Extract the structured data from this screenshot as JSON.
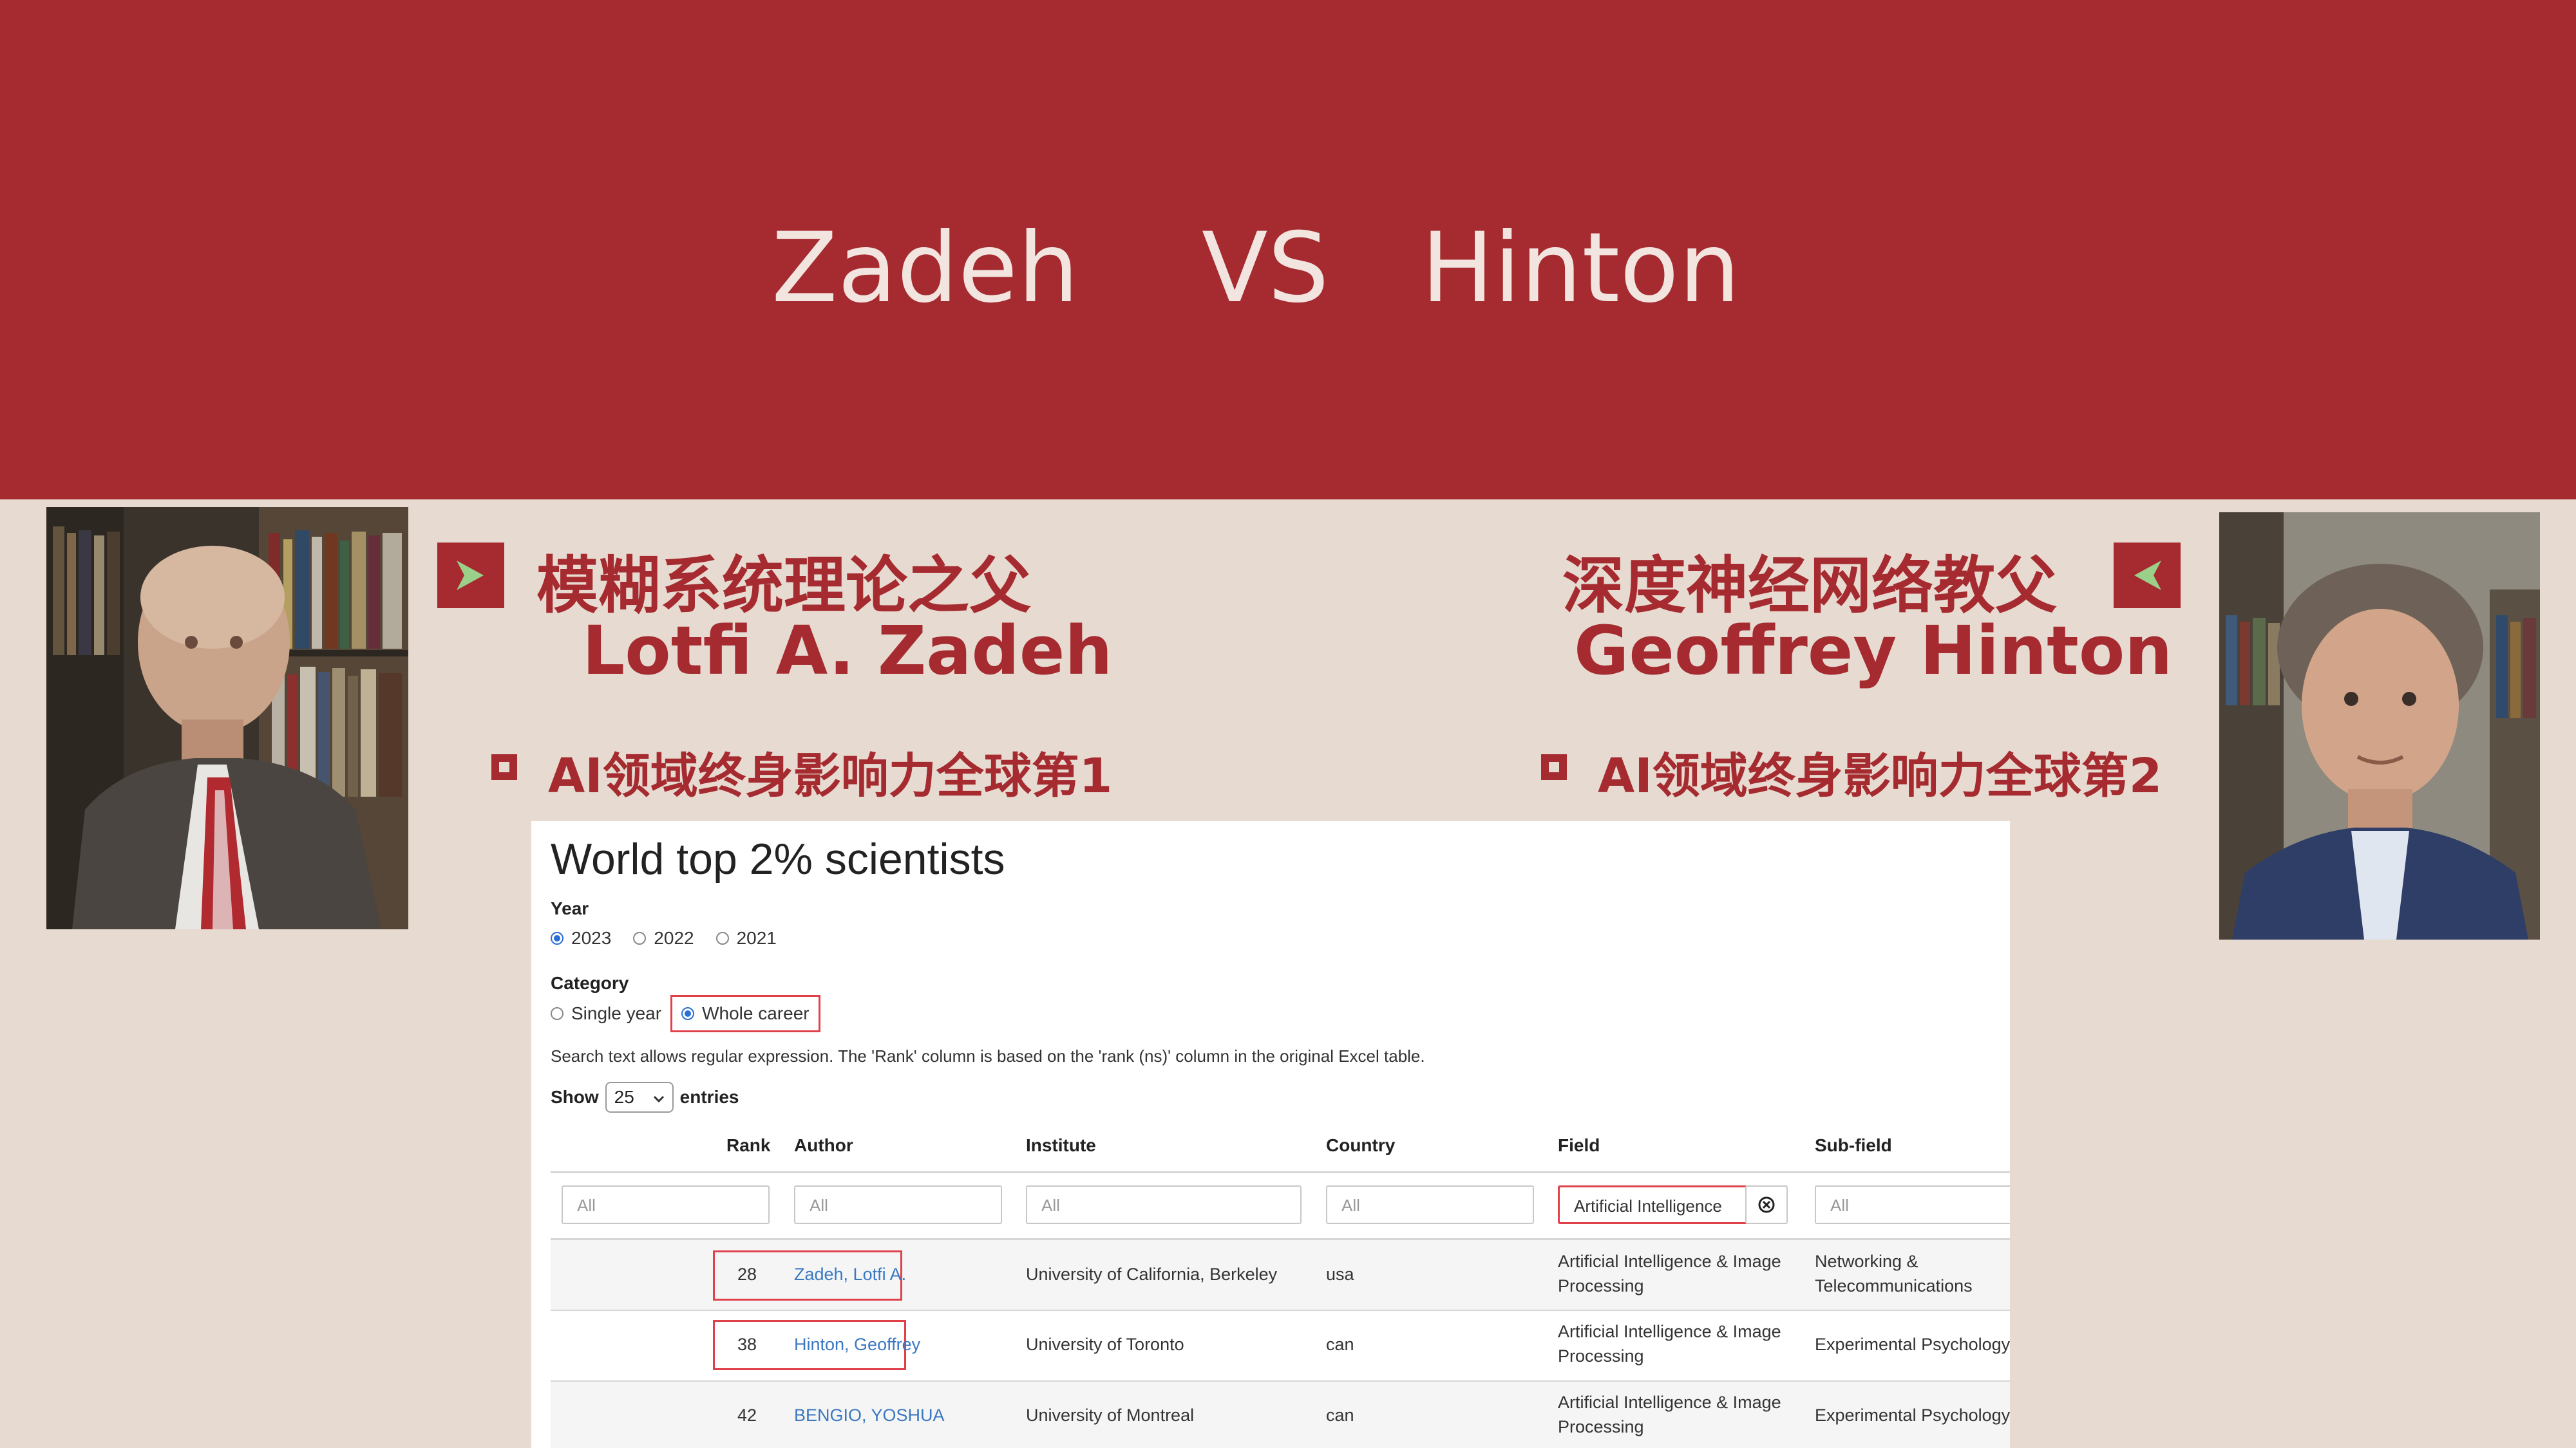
{
  "banner": {
    "title": "Zadeh    VS   Hinton"
  },
  "left": {
    "title_zh": "模糊系统理论之父",
    "name": "Lotfi A. Zadeh",
    "bullet": "AI领域终身影响力全球第1"
  },
  "right": {
    "title_zh": "深度神经网络教父",
    "name": "Geoffrey Hinton",
    "bullet": "AI领域终身影响力全球第2"
  },
  "panel": {
    "title": "World top 2% scientists",
    "year": {
      "label": "Year",
      "options": [
        "2023",
        "2022",
        "2021"
      ],
      "selected": "2023"
    },
    "category": {
      "label": "Category",
      "options": [
        "Single year",
        "Whole career"
      ],
      "selected": "Whole career"
    },
    "note": "Search text allows regular expression. The 'Rank' column is based on the 'rank (ns)' column in the original Excel table.",
    "show": {
      "prefix": "Show",
      "value": "25",
      "suffix": "entries"
    },
    "columns": [
      "Rank",
      "Author",
      "Institute",
      "Country",
      "Field",
      "Sub-field"
    ],
    "filters": {
      "rank": "All",
      "author": "All",
      "institute": "All",
      "country": "All",
      "field": "Artificial Intelligence",
      "subfield": "All"
    },
    "rows": [
      {
        "rank": "28",
        "author": "Zadeh, Lotfi A.",
        "institute": "University of California, Berkeley",
        "country": "usa",
        "field_l1": "Artificial Intelligence & Image",
        "field_l2": "Processing",
        "sub_l1": "Networking &",
        "sub_l2": "Telecommunications"
      },
      {
        "rank": "38",
        "author": "Hinton, Geoffrey",
        "institute": "University of Toronto",
        "country": "can",
        "field_l1": "Artificial Intelligence & Image",
        "field_l2": "Processing",
        "sub_l1": "Experimental Psychology",
        "sub_l2": ""
      },
      {
        "rank": "42",
        "author": "BENGIO, YOSHUA",
        "institute": "University of Montreal",
        "country": "can",
        "field_l1": "Artificial Intelligence & Image",
        "field_l2": "Processing",
        "sub_l1": "Experimental Psychology",
        "sub_l2": ""
      }
    ]
  },
  "colors": {
    "brand_red": "#a52b30",
    "background": "#e7dad0",
    "arrow_green": "#9bd08a",
    "link_blue": "#3a78c2",
    "highlight_red": "#e0404a"
  }
}
